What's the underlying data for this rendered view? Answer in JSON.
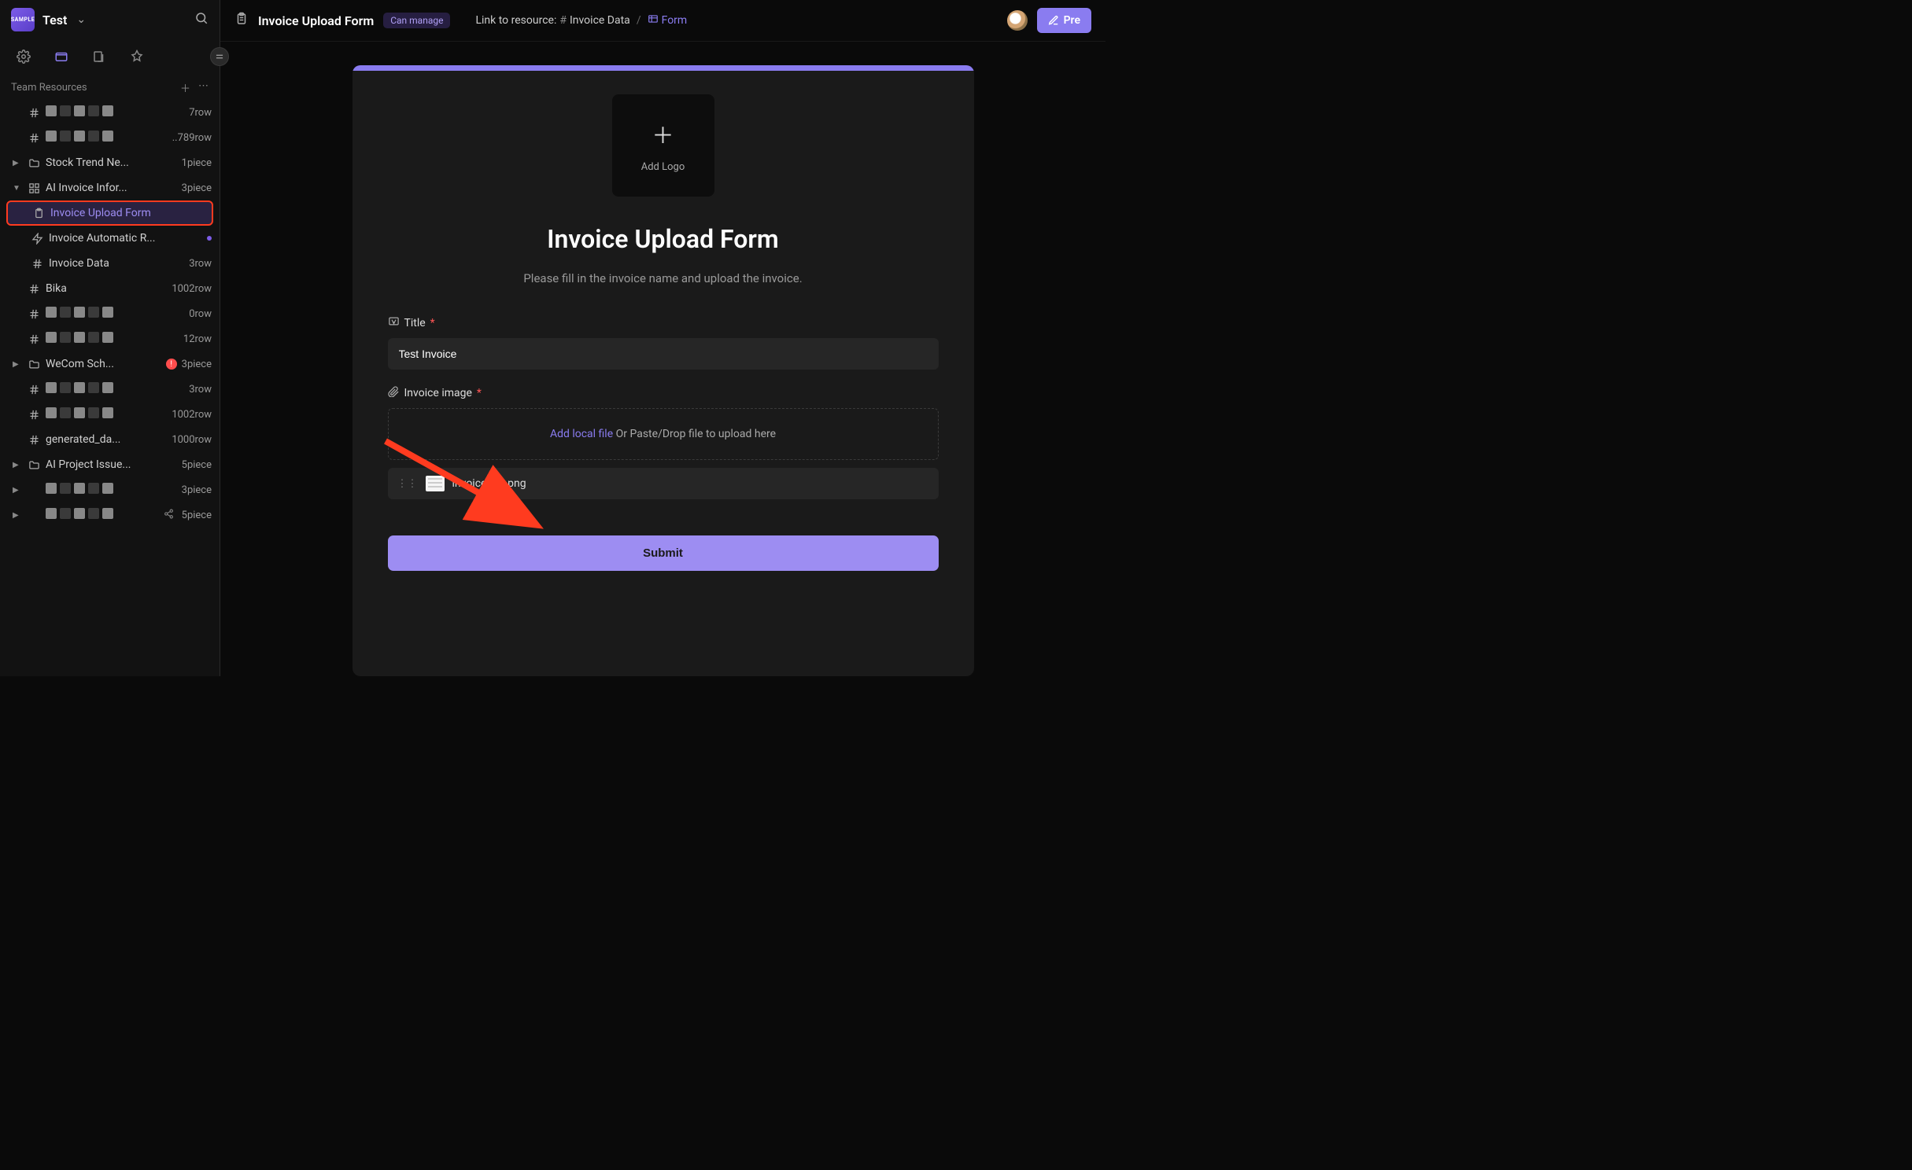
{
  "workspace": {
    "badge": "SAMPLE",
    "name": "Test"
  },
  "section": {
    "title": "Team Resources"
  },
  "tree": [
    {
      "type": "item",
      "icon": "hash",
      "label": "#####",
      "suffix": "7row",
      "redacted": true,
      "caret": ""
    },
    {
      "type": "item",
      "icon": "hash",
      "label": "#####",
      "suffix": "..789row",
      "redacted": true,
      "caret": ""
    },
    {
      "type": "item",
      "icon": "folder",
      "label": "Stock Trend Ne...",
      "suffix": "1piece",
      "caret": "▶"
    },
    {
      "type": "item",
      "icon": "grid",
      "label": "AI Invoice Infor...",
      "suffix": "3piece",
      "caret": "▼"
    },
    {
      "type": "child",
      "icon": "clipboard",
      "label": "Invoice Upload Form",
      "selected": true
    },
    {
      "type": "child",
      "icon": "bolt",
      "label": "Invoice Automatic R...",
      "dot": true
    },
    {
      "type": "child",
      "icon": "hash",
      "label": "Invoice Data",
      "suffix": "3row"
    },
    {
      "type": "item",
      "icon": "hash",
      "label": "Bika",
      "suffix": "1002row",
      "caret": ""
    },
    {
      "type": "item",
      "icon": "hash",
      "label": "#####",
      "suffix": "0row",
      "redacted": true,
      "caret": ""
    },
    {
      "type": "item",
      "icon": "hash",
      "label": "#####",
      "suffix": "12row",
      "redacted": true,
      "caret": ""
    },
    {
      "type": "item",
      "icon": "folder",
      "label": "WeCom Sch...",
      "suffix": "3piece",
      "caret": "▶",
      "error": true
    },
    {
      "type": "item",
      "icon": "hash",
      "label": "#####",
      "suffix": "3row",
      "redacted": true,
      "caret": ""
    },
    {
      "type": "item",
      "icon": "hash",
      "label": "#####",
      "suffix": "1002row",
      "redacted": true,
      "caret": ""
    },
    {
      "type": "item",
      "icon": "hash",
      "label": "generated_da...",
      "suffix": "1000row",
      "caret": ""
    },
    {
      "type": "item",
      "icon": "folder",
      "label": "AI Project Issue...",
      "suffix": "5piece",
      "caret": "▶"
    },
    {
      "type": "item",
      "icon": "blank",
      "label": "#####",
      "suffix": "3piece",
      "redacted": true,
      "caret": "▶"
    },
    {
      "type": "item",
      "icon": "blank",
      "label": "#####",
      "suffix": "5piece",
      "redacted": true,
      "caret": "▶",
      "share": true
    }
  ],
  "topbar": {
    "title": "Invoice Upload Form",
    "permission": "Can manage",
    "link_label": "Link to resource:",
    "resource_name": "Invoice Data",
    "form_link": "Form",
    "preview_label": "Pre"
  },
  "form": {
    "logo_label": "Add Logo",
    "title": "Invoice Upload Form",
    "description": "Please fill in the invoice name and upload the invoice.",
    "fields": {
      "title": {
        "label": "Title",
        "value": "Test Invoice"
      },
      "image": {
        "label": "Invoice image",
        "add_link": "Add local file",
        "drop_hint": " Or Paste/Drop file to upload here"
      }
    },
    "uploaded_file": "invoice-tax.png",
    "submit": "Submit"
  }
}
